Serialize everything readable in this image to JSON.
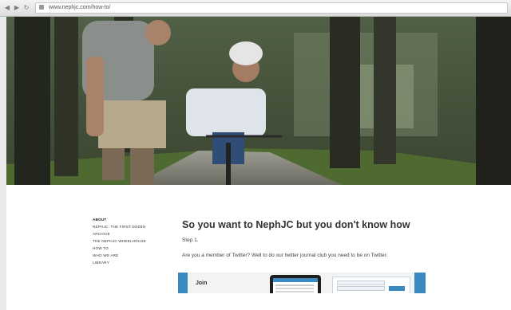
{
  "browser": {
    "url": "www.nephjc.com/how-to/"
  },
  "nav": {
    "items": [
      {
        "label": "ABOUT",
        "active": true
      },
      {
        "label": "NEPHJC: THE FIRST DOZEN",
        "active": false
      },
      {
        "label": "ARCHIVE",
        "active": false
      },
      {
        "label": "THE NEPHJC WHEELHOUSE",
        "active": false
      },
      {
        "label": "HOW TO",
        "active": false
      },
      {
        "label": "WHO WE ARE",
        "active": false
      },
      {
        "label": "LIBRARY",
        "active": false
      }
    ]
  },
  "main": {
    "title": "So you want to NephJC but you don't know how",
    "step": "Step 1.",
    "paragraph": "Are you a member of Twitter? Well to do our twitter journal club you need to be on Twitter."
  },
  "promo": {
    "text": "Join"
  },
  "colors": {
    "accent": "#3a8ac2"
  }
}
